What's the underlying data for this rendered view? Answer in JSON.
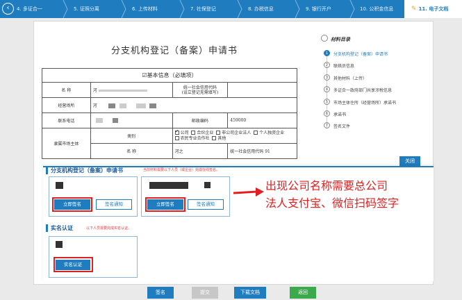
{
  "steps": [
    {
      "label": "4. 多证合一"
    },
    {
      "label": "5. 证照分离"
    },
    {
      "label": "6. 上传材料"
    },
    {
      "label": "7. 社保登记"
    },
    {
      "label": "8. 办税信息"
    },
    {
      "label": "9. 银行开户"
    },
    {
      "label": "10. 公积金信息"
    },
    {
      "label": "11. 电子文档",
      "active": true
    }
  ],
  "document": {
    "title": "分支机构登记（备案）申请书",
    "section_title": "☑基本信息（必填项）",
    "rows": {
      "name_label": "名  称",
      "name_value": "河",
      "credit_code_label": "统一社会信用代码",
      "credit_code_sub": "(设立登记无需填写)",
      "address_label": "经营场所",
      "address_value": "河",
      "phone_label": "联系电话",
      "postcode_label": "邮政编码",
      "postcode_value": "459000",
      "type_label": "类别",
      "type_options": [
        "公司",
        "合伙企业",
        "非公司企业法人",
        "个人独资企业",
        "农民专业合作社",
        "其他"
      ],
      "affiliate_label": "隶属市场主体",
      "affiliate_name_label": "名  称",
      "affiliate_name_value": "河之",
      "affiliate_code_label": "统一社会信用代码",
      "affiliate_code_value": "91"
    }
  },
  "toc": {
    "heading": "材料目录",
    "items": [
      {
        "num": "1",
        "label": "分支机构登记（备案）申请书",
        "active": true
      },
      {
        "num": "2",
        "label": "联络员信息"
      },
      {
        "num": "3",
        "label": "其他材料（上传）"
      },
      {
        "num": "4",
        "label": "多证合一政府部门共享涉税信息"
      },
      {
        "num": "5",
        "label": "市场主体住所（经营场所）承诺书"
      },
      {
        "num": "6",
        "label": "承诺书"
      },
      {
        "num": "7",
        "label": "签名文件"
      }
    ]
  },
  "close_label": "关闭",
  "sign_section": {
    "title": "分支机构登记（备案）申请书",
    "note": "当前材料需要以下人员（或企业）完成在线签名。",
    "sign_label": "立即签名",
    "notify_label": "签名通知"
  },
  "verify_section": {
    "title": "实名认证",
    "note": "以下人员需要完成实名认证。",
    "verify_label": "实名认证"
  },
  "annotation": {
    "line1": "出现公司名称需要总公司",
    "line2": "法人支付宝、微信扫码签字"
  },
  "bottom": {
    "sign": "签名",
    "submit": "提交",
    "download": "下载文档",
    "back": "返回"
  },
  "colors": {
    "primary": "#1f7dbf",
    "disabled": "#c7c7c7",
    "success": "#3aaa4a",
    "highlight": "#e02020"
  }
}
